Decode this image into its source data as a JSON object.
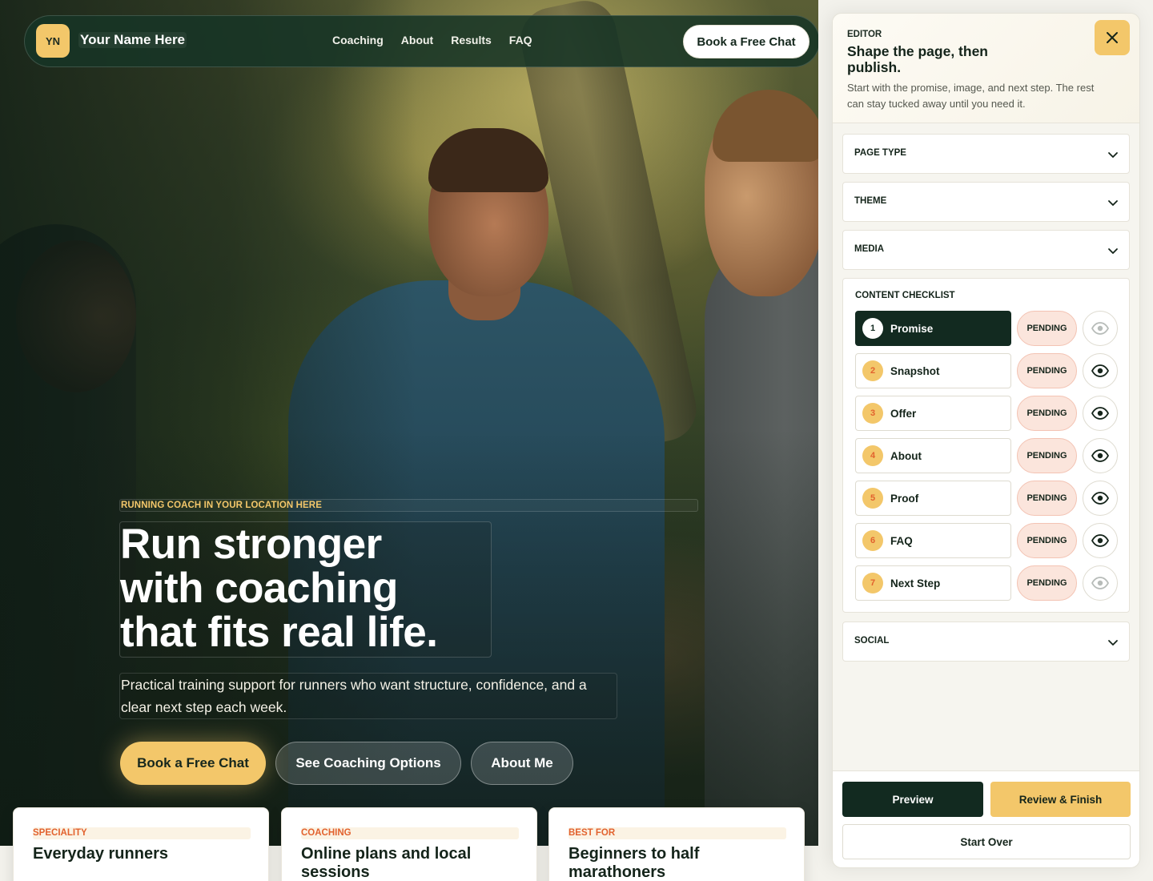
{
  "nav": {
    "logo_initials": "YN",
    "brand": "Your Name Here",
    "links": [
      "Coaching",
      "About",
      "Results",
      "FAQ"
    ],
    "cta": "Book a Free Chat"
  },
  "hero": {
    "eyebrow": "RUNNING COACH IN YOUR LOCATION HERE",
    "headline_lines": [
      "Run stronger",
      "with coaching",
      "that fits real life."
    ],
    "subhead": "Practical training support for runners who want structure, confidence, and a clear next step each week.",
    "buttons": {
      "primary": "Book a Free Chat",
      "options": "See Coaching Options",
      "about": "About Me"
    }
  },
  "cards": [
    {
      "label": "SPECIALITY",
      "title": "Everyday runners"
    },
    {
      "label": "COACHING",
      "title": "Online plans and local sessions"
    },
    {
      "label": "BEST FOR",
      "title": "Beginners to half marathoners"
    }
  ],
  "editor": {
    "kicker": "EDITOR",
    "title": "Shape the page, then publish.",
    "description": "Start with the promise, image, and next step. The rest can stay tucked away until you need it.",
    "sections": [
      "PAGE TYPE",
      "THEME",
      "MEDIA"
    ],
    "checklist": {
      "title": "CONTENT CHECKLIST",
      "items": [
        {
          "num": "1",
          "name": "Promise",
          "status": "PENDING"
        },
        {
          "num": "2",
          "name": "Snapshot",
          "status": "PENDING"
        },
        {
          "num": "3",
          "name": "Offer",
          "status": "PENDING"
        },
        {
          "num": "4",
          "name": "About",
          "status": "PENDING"
        },
        {
          "num": "5",
          "name": "Proof",
          "status": "PENDING"
        },
        {
          "num": "6",
          "name": "FAQ",
          "status": "PENDING"
        },
        {
          "num": "7",
          "name": "Next Step",
          "status": "PENDING"
        }
      ]
    },
    "social": "SOCIAL",
    "footer": {
      "preview": "Preview",
      "review": "Review & Finish",
      "start_over": "Start Over"
    }
  },
  "colors": {
    "accent": "#f3c76a",
    "dark": "#122a20",
    "status_pink": "#fbe5dc",
    "label_orange": "#e2622e"
  }
}
